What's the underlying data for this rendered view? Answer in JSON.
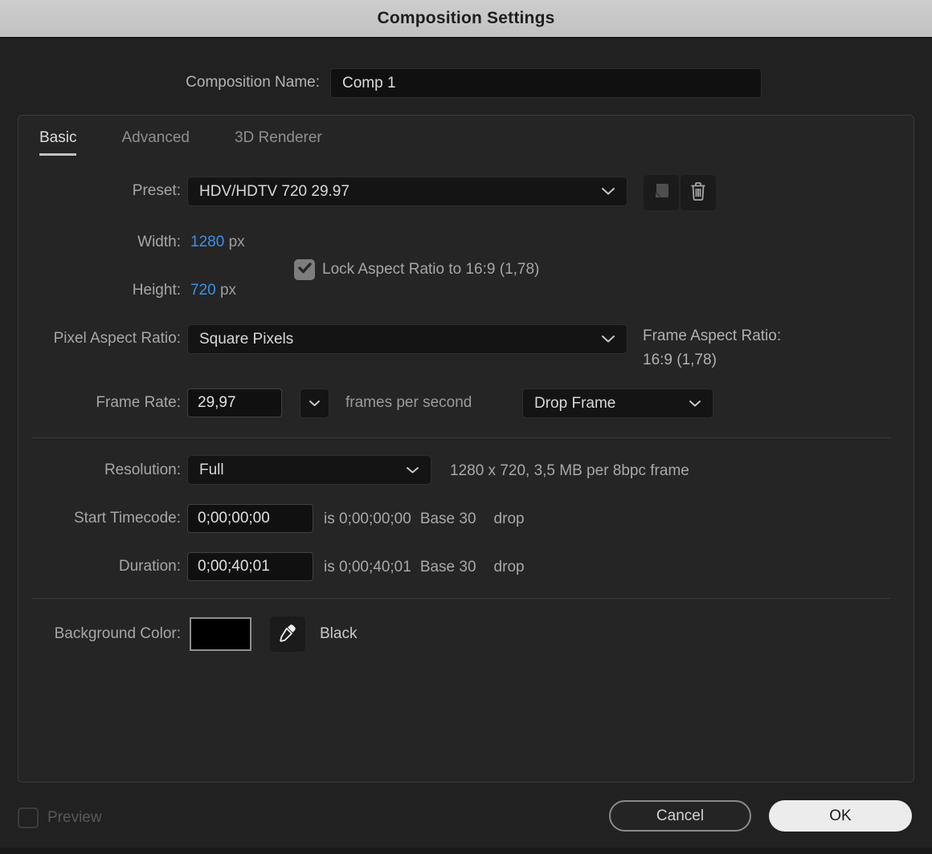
{
  "title": "Composition Settings",
  "composition_name": {
    "label": "Composition Name:",
    "value": "Comp 1"
  },
  "tabs": [
    {
      "label": "Basic",
      "active": true
    },
    {
      "label": "Advanced",
      "active": false
    },
    {
      "label": "3D Renderer",
      "active": false
    }
  ],
  "preset": {
    "label": "Preset:",
    "value": "HDV/HDTV 720 29.97"
  },
  "width": {
    "label": "Width:",
    "value": "1280",
    "unit": "px"
  },
  "height": {
    "label": "Height:",
    "value": "720",
    "unit": "px"
  },
  "lock_aspect": {
    "label": "Lock Aspect Ratio to 16:9 (1,78)",
    "checked": true
  },
  "pixel_aspect_ratio": {
    "label": "Pixel Aspect Ratio:",
    "value": "Square Pixels"
  },
  "frame_aspect_ratio": {
    "line1": "Frame Aspect Ratio:",
    "line2": "16:9 (1,78)"
  },
  "frame_rate": {
    "label": "Frame Rate:",
    "value": "29,97",
    "suffix": "frames per second",
    "drop_frame_value": "Drop Frame"
  },
  "resolution": {
    "label": "Resolution:",
    "value": "Full",
    "info": "1280 x 720, 3,5 MB per 8bpc frame"
  },
  "start_timecode": {
    "label": "Start Timecode:",
    "value": "0;00;00;00",
    "is_text": "is 0;00;00;00",
    "base_text": "Base 30",
    "drop_text": "drop"
  },
  "duration": {
    "label": "Duration:",
    "value": "0;00;40;01",
    "is_text": "is 0;00;40;01",
    "base_text": "Base 30",
    "drop_text": "drop"
  },
  "background_color": {
    "label": "Background Color:",
    "color_name": "Black",
    "swatch_hex": "#000000"
  },
  "footer": {
    "preview_label": "Preview",
    "cancel_label": "Cancel",
    "ok_label": "OK"
  },
  "colors": {
    "accent_blue": "#3d8fe6",
    "titlebar_bg": "#c6c6c6",
    "dialog_bg": "#212121",
    "panel_bg": "#252525",
    "field_bg": "#101010"
  }
}
